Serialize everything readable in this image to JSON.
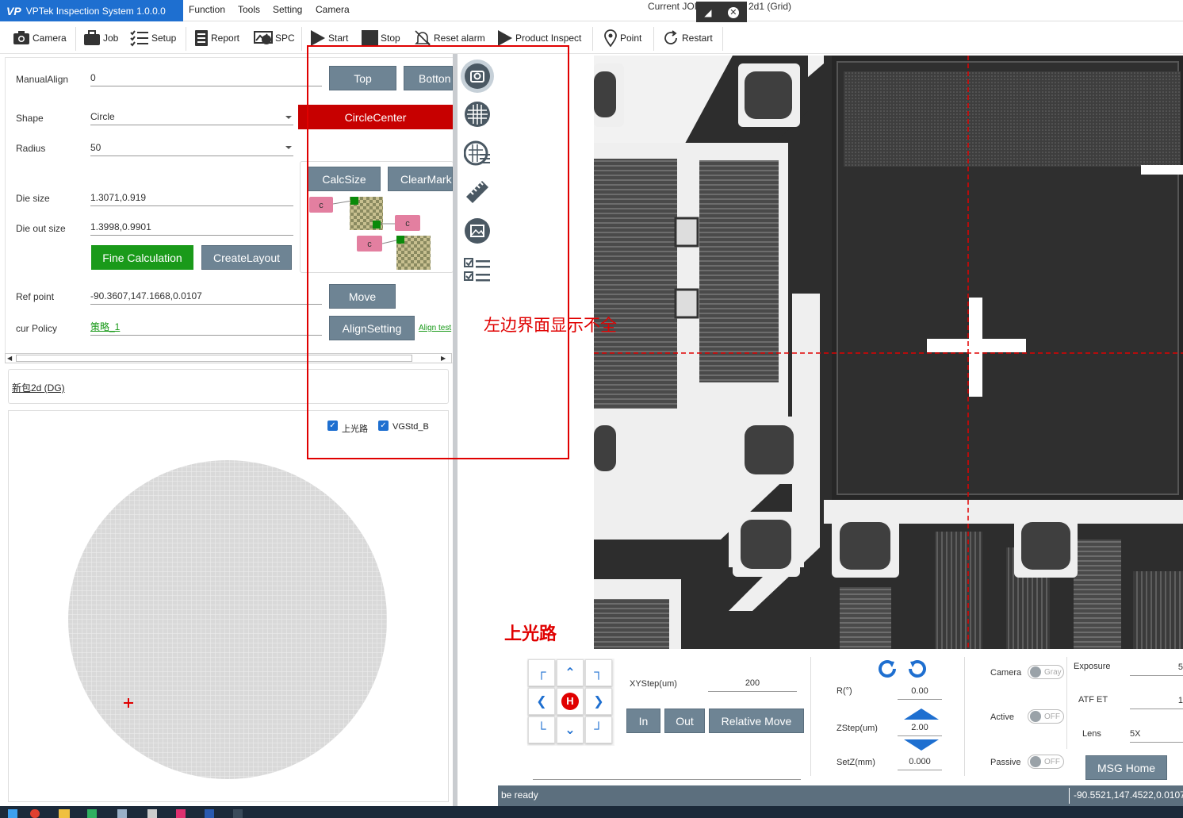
{
  "app": {
    "brand_logo": "VP",
    "title": "VPTek Inspection System 1.0.0.0"
  },
  "menu": [
    "Function",
    "Tools",
    "Setting",
    "Camera"
  ],
  "job": {
    "prefix": "Current JOI",
    "suffix": "2d1 (Grid)"
  },
  "toolbar": [
    {
      "label": "Camera",
      "icon": "camera-icon"
    },
    {
      "label": "Job",
      "icon": "briefcase-icon"
    },
    {
      "label": "Setup",
      "icon": "checklist-icon"
    },
    {
      "label": "Report",
      "icon": "report-icon"
    },
    {
      "label": "SPC",
      "icon": "spc-icon"
    },
    {
      "label": "Start",
      "icon": "play-icon"
    },
    {
      "label": "Stop",
      "icon": "stop-icon"
    },
    {
      "label": "Reset alarm",
      "icon": "bell-off-icon"
    },
    {
      "label": "Product Inspect",
      "icon": "play-icon"
    },
    {
      "label": "Point",
      "icon": "pin-icon"
    },
    {
      "label": "Restart",
      "icon": "restart-icon"
    }
  ],
  "form": {
    "manual_align": {
      "label": "ManualAlign",
      "value": "0"
    },
    "shape": {
      "label": "Shape",
      "value": "Circle"
    },
    "radius": {
      "label": "Radius",
      "value": "50"
    },
    "die_size": {
      "label": "Die size",
      "value": "1.3071,0.919"
    },
    "die_out_size": {
      "label": "Die out size",
      "value": "1.3998,0.9901"
    },
    "ref_point": {
      "label": "Ref point",
      "value": "-90.3607,147.1668,0.0107"
    },
    "cur_policy": {
      "label": "cur Policy",
      "value": "策略_1"
    }
  },
  "buttons": {
    "top": "Top",
    "bottom": "Botton",
    "circle_center": "CircleCenter",
    "calc_size": "CalcSize",
    "clear_mark": "ClearMark",
    "fine_calc": "Fine Calculation",
    "create_layout": "CreateLayout",
    "move": "Move",
    "align_setting": "AlignSetting",
    "align_test": "Align test"
  },
  "diagram_labels": [
    "c",
    "c",
    "c"
  ],
  "recipe_link": "新包2d (DG)",
  "checkboxes": [
    {
      "label": "上光路",
      "checked": true
    },
    {
      "label": "VGStd_B",
      "checked": true
    }
  ],
  "side_icons": [
    "camera-icon",
    "wafer-icon",
    "wafer-settings-icon",
    "ruler-icon",
    "image-icon",
    "checklist-icon"
  ],
  "annotations": {
    "left_ui": "左边界面显示不全",
    "image_label": "上光路"
  },
  "jog": {
    "center": "H",
    "xystep_label": "XYStep(um)",
    "xystep_value": "200",
    "in": "In",
    "out": "Out",
    "relative_move": "Relative Move"
  },
  "axis": {
    "r_label": "R(°)",
    "r_value": "0.00",
    "zstep_label": "ZStep(um)",
    "zstep_value": "2.00",
    "setz_label": "SetZ(mm)",
    "setz_value": "0.000"
  },
  "camera_panel": {
    "camera_label": "Camera",
    "camera_toggle": "Gray",
    "active_label": "Active",
    "active_toggle": "OFF",
    "passive_label": "Passive",
    "passive_toggle": "OFF",
    "exposure_label": "Exposure",
    "exposure_value": "5",
    "atf_label": "ATF ET",
    "atf_value": "1",
    "lens_label": "Lens",
    "lens_value": "5X",
    "msg_home": "MSG Home"
  },
  "status": {
    "message": "be ready",
    "coords": "-90.5521,147.4522,0.0107"
  },
  "colors": {
    "brand": "#1e6fd0",
    "button_gray": "#6e8494",
    "green": "#1a9a1a",
    "red": "#c70000",
    "annotation": "#e00000",
    "status_bar": "#5c6f7e"
  }
}
